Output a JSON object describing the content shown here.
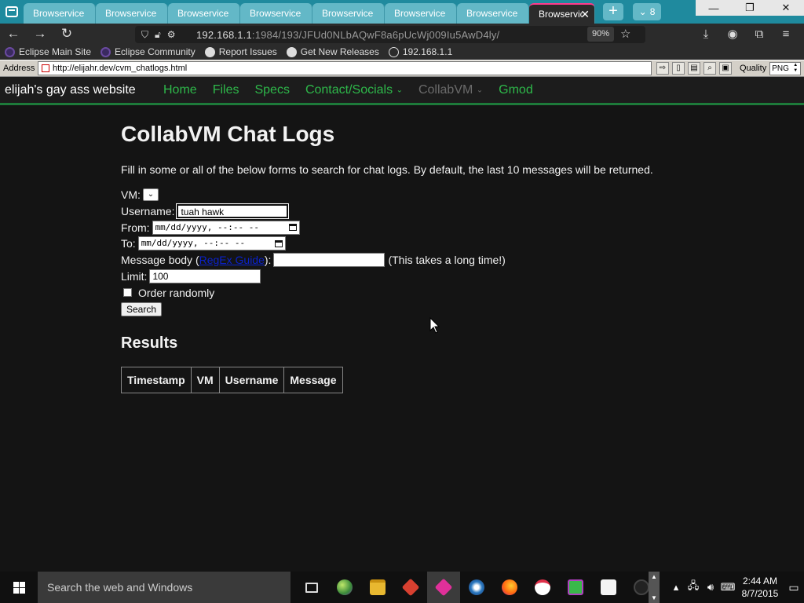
{
  "browser": {
    "tabs": [
      {
        "label": "Browservice",
        "active": false
      },
      {
        "label": "Browservice",
        "active": false
      },
      {
        "label": "Browservice",
        "active": false
      },
      {
        "label": "Browservice",
        "active": false
      },
      {
        "label": "Browservice",
        "active": false
      },
      {
        "label": "Browservice",
        "active": false
      },
      {
        "label": "Browservice",
        "active": false
      },
      {
        "label": "Browservic",
        "active": true
      }
    ],
    "new_tab_symbol": "+",
    "tab_count": "8",
    "url_host": "192.168.1.1",
    "url_rest": ":1984/193/JFUd0NLbAQwF8a6pUcWj009Iu5AwD4ly/",
    "zoom": "90%",
    "bookmarks": [
      {
        "label": "Eclipse Main Site",
        "icon": "eclipse-icon"
      },
      {
        "label": "Eclipse Community",
        "icon": "eclipse-icon"
      },
      {
        "label": "Report Issues",
        "icon": "github-icon"
      },
      {
        "label": "Get New Releases",
        "icon": "github-icon"
      },
      {
        "label": "192.168.1.1",
        "icon": "globe-icon"
      }
    ],
    "address_label": "Address",
    "address_value": "http://elijahr.dev/cvm_chatlogs.html",
    "quality_label": "Quality",
    "quality_value": "PNG"
  },
  "site": {
    "brand": "elijah's gay ass website",
    "nav": [
      {
        "label": "Home",
        "disabled": false,
        "dropdown": false
      },
      {
        "label": "Files",
        "disabled": false,
        "dropdown": false
      },
      {
        "label": "Specs",
        "disabled": false,
        "dropdown": false
      },
      {
        "label": "Contact/Socials",
        "disabled": false,
        "dropdown": true
      },
      {
        "label": "CollabVM",
        "disabled": true,
        "dropdown": true
      },
      {
        "label": "Gmod",
        "disabled": false,
        "dropdown": false
      }
    ],
    "title": "CollabVM Chat Logs",
    "intro": "Fill in some or all of the below forms to search for chat logs. By default, the last 10 messages will be returned.",
    "form": {
      "vm_label": "VM:",
      "username_label": "Username:",
      "username_value": "tuah hawk",
      "from_label": "From:",
      "from_placeholder": "mm/dd/yyyy, --:-- --",
      "to_label": "To:",
      "to_placeholder": "mm/dd/yyyy, --:-- --",
      "message_label_pre": "Message body (",
      "message_link": "RegEx Guide",
      "message_label_post": "):",
      "message_note": "(This takes a long time!)",
      "limit_label": "Limit:",
      "limit_value": "100",
      "random_label": "Order randomly",
      "search_button": "Search"
    },
    "results_title": "Results",
    "columns": [
      "Timestamp",
      "VM",
      "Username",
      "Message"
    ]
  },
  "taskbar": {
    "search_placeholder": "Search the web and Windows",
    "time": "2:44 AM",
    "date": "8/7/2015"
  }
}
